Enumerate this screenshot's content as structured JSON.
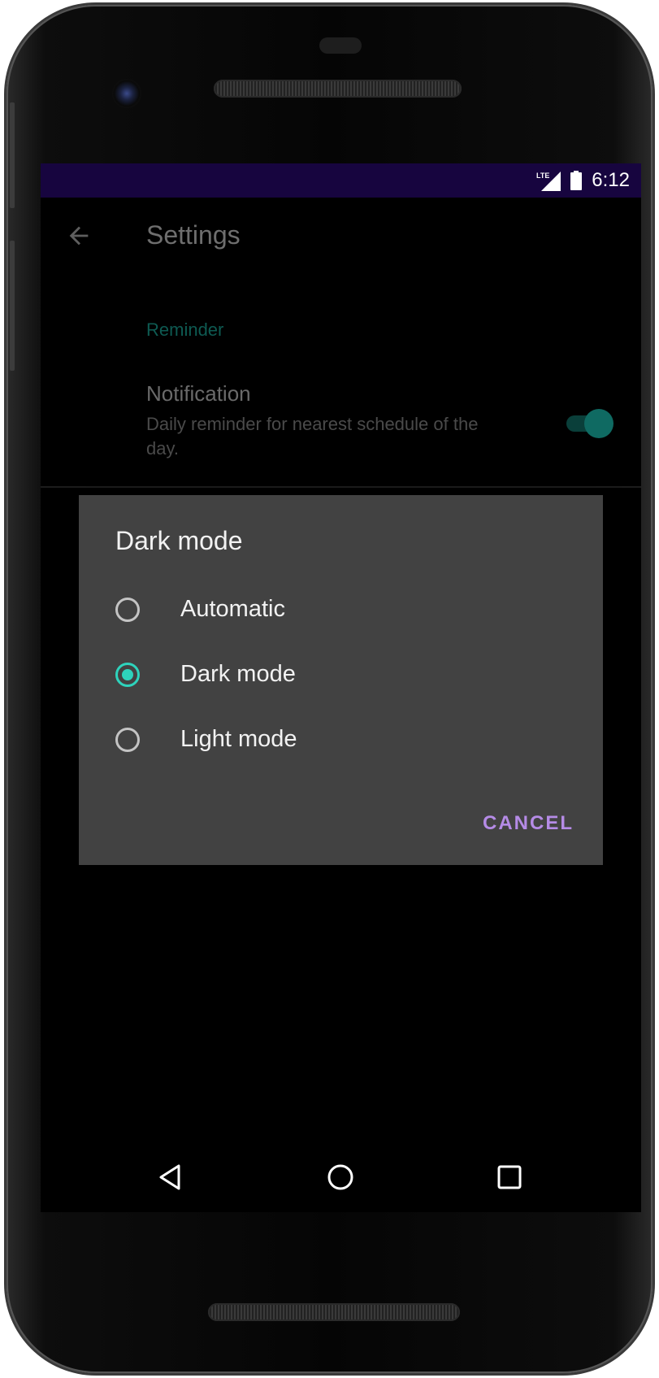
{
  "status_bar": {
    "network_label": "LTE",
    "time": "6:12",
    "icons": [
      "lte-signal-icon",
      "battery-icon"
    ]
  },
  "app_bar": {
    "back_icon": "arrow-left-icon",
    "title": "Settings"
  },
  "preferences": {
    "section_header": "Reminder",
    "notification": {
      "title": "Notification",
      "summary": "Daily reminder for nearest schedule of the day.",
      "enabled": true
    }
  },
  "dialog": {
    "title": "Dark mode",
    "options": [
      {
        "label": "Automatic",
        "selected": false
      },
      {
        "label": "Dark mode",
        "selected": true
      },
      {
        "label": "Light mode",
        "selected": false
      }
    ],
    "cancel_label": "CANCEL"
  },
  "nav_bar": {
    "icons": [
      "back-triangle-icon",
      "home-circle-icon",
      "recents-square-icon"
    ]
  },
  "colors": {
    "status_bar_bg": "#17053f",
    "accent_teal": "#2ed3bc",
    "cancel_purple": "#b58be6",
    "dialog_bg": "#424242"
  }
}
